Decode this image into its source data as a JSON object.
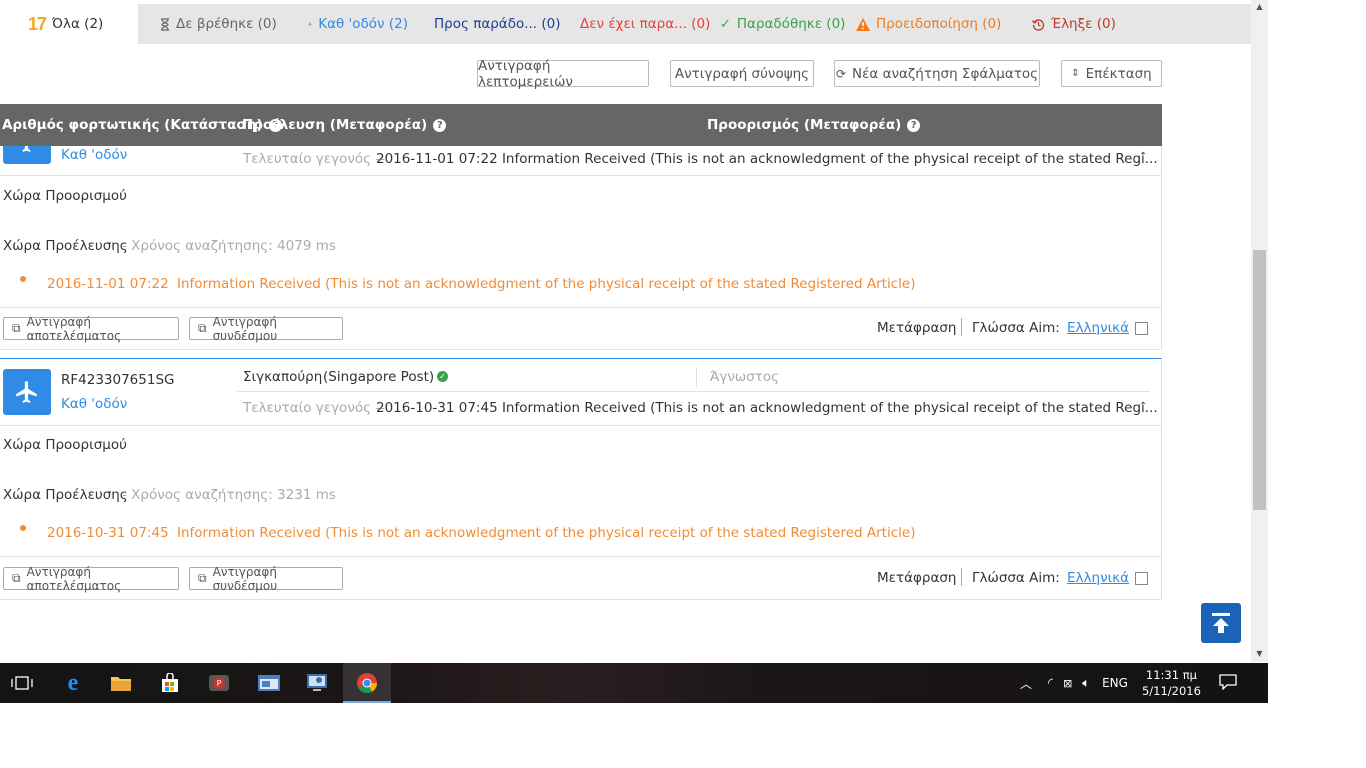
{
  "tabs": [
    {
      "label": "Όλα (2)",
      "color": "#333333",
      "icon": "logo-17"
    },
    {
      "label": "Δε βρέθηκε (0)",
      "color": "#666666",
      "icon": "hourglass-icon"
    },
    {
      "label": "Καθ 'οδόν (2)",
      "color": "#2f8be6",
      "icon": "plane-icon"
    },
    {
      "label": "Προς παράδο... (0)",
      "color": "#1f3f8f",
      "icon": "flag-icon"
    },
    {
      "label": "Δεν έχει παρα... (0)",
      "color": "#e2423b",
      "icon": "sad-face-icon"
    },
    {
      "label": "Παραδόθηκε (0)",
      "color": "#3aa14a",
      "icon": "check-icon"
    },
    {
      "label": "Προειδοποίηση (0)",
      "color": "#f07c1d",
      "icon": "warning-icon"
    },
    {
      "label": "Έληξε (0)",
      "color": "#c0392b",
      "icon": "history-icon"
    }
  ],
  "logo_text": "17",
  "actions": {
    "copy_details": "Αντιγραφή λεπτομερειών",
    "copy_summary": "Αντιγραφή σύνοψης",
    "new_search": "Νέα αναζήτηση Σφάλματος",
    "expand": "Επέκταση"
  },
  "table_header": {
    "col1": "Αριθμός φορτωτικής (Κατάσταση)",
    "col2": "Προέλευση (Μεταφορέα)",
    "col3": "Προορισμός (Μεταφορέα)"
  },
  "cards": [
    {
      "tracking_no": "",
      "status": "Καθ 'οδόν",
      "origin": "",
      "destination": "",
      "last_event_label": "Τελευταίο γεγονός --",
      "last_event": "2016-11-01 07:22 Information Received (This is not an acknowledgment of the physical receipt of the stated Regi...",
      "dest_country": "Χώρα Προορισμού",
      "origin_country": "Χώρα Προέλευσης",
      "search_time": "- Χρόνος αναζήτησης: 4079 ms",
      "event_date": "2016-11-01 07:22",
      "event_text": "Information Received (This is not an acknowledgment of the physical receipt of the stated Registered Article)",
      "copy_result": "Αντιγραφή αποτελέσματος",
      "copy_link": "Αντιγραφή συνδέσμου",
      "translate": "Μετάφραση",
      "language_label": "Γλώσσα Aim:",
      "language": "Ελληνικά"
    },
    {
      "tracking_no": "RF423307651SG",
      "status": "Καθ 'οδόν",
      "origin": "Σιγκαπούρη",
      "origin_carrier": "(Singapore Post)",
      "destination": "Άγνωστος",
      "last_event_label": "Τελευταίο γεγονός --",
      "last_event": "2016-10-31 07:45 Information Received (This is not an acknowledgment of the physical receipt of the stated Regi...",
      "dest_country": "Χώρα Προορισμού",
      "origin_country": "Χώρα Προέλευσης",
      "search_time": "- Χρόνος αναζήτησης: 3231 ms",
      "event_date": "2016-10-31 07:45",
      "event_text": "Information Received (This is not an acknowledgment of the physical receipt of the stated Registered Article)",
      "copy_result": "Αντιγραφή αποτελέσματος",
      "copy_link": "Αντιγραφή συνδέσμου",
      "translate": "Μετάφραση",
      "language_label": "Γλώσσα Aim:",
      "language": "Ελληνικά"
    }
  ],
  "taskbar": {
    "apps": [
      "task-view-icon",
      "edge-icon",
      "file-explorer-icon",
      "store-icon",
      "app-red-icon",
      "app-window-icon",
      "app-remote-icon",
      "chrome-icon"
    ],
    "lang": "ENG",
    "time": "11:31 πμ",
    "date": "5/11/2016"
  },
  "colors": {
    "accent_blue": "#2f8be6",
    "header_gray": "#666666",
    "event_orange": "#f08c36",
    "to_top_blue": "#1a63b8"
  }
}
